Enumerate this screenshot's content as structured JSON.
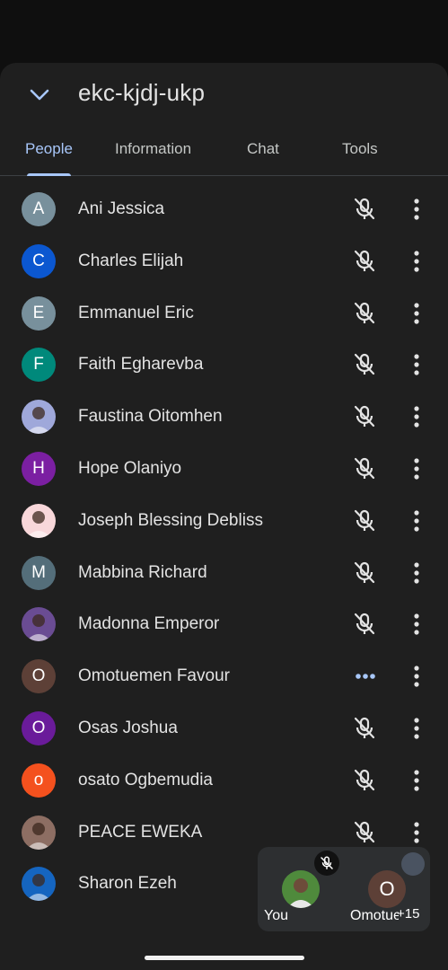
{
  "meeting": {
    "code": "ekc-kjdj-ukp"
  },
  "tabs": [
    {
      "label": "People",
      "active": true
    },
    {
      "label": "Information",
      "active": false
    },
    {
      "label": "Chat",
      "active": false
    },
    {
      "label": "Tools",
      "active": false
    }
  ],
  "participants": [
    {
      "name": "Ani Jessica",
      "initial": "A",
      "color": "#78909c",
      "status": "muted"
    },
    {
      "name": "Charles Elijah",
      "initial": "C",
      "color": "#0b57d0",
      "status": "muted"
    },
    {
      "name": "Emmanuel Eric",
      "initial": "E",
      "color": "#78909c",
      "status": "muted"
    },
    {
      "name": "Faith Egharevba",
      "initial": "F",
      "color": "#00897b",
      "status": "muted"
    },
    {
      "name": "Faustina Oitomhen",
      "initial": "",
      "color": "#9fa8da",
      "status": "muted"
    },
    {
      "name": "Hope Olaniyo",
      "initial": "H",
      "color": "#7b1fa2",
      "status": "muted"
    },
    {
      "name": "Joseph Blessing Debliss",
      "initial": "",
      "color": "#f8d7da",
      "status": "muted"
    },
    {
      "name": "Mabbina Richard",
      "initial": "M",
      "color": "#546e7a",
      "status": "muted"
    },
    {
      "name": "Madonna Emperor",
      "initial": "",
      "color": "#6a4c93",
      "status": "muted"
    },
    {
      "name": "Omotuemen Favour",
      "initial": "O",
      "color": "#5d4037",
      "status": "speaking"
    },
    {
      "name": "Osas Joshua",
      "initial": "O",
      "color": "#6a1b9a",
      "status": "muted"
    },
    {
      "name": "osato Ogbemudia",
      "initial": "o",
      "color": "#f4511e",
      "status": "muted"
    },
    {
      "name": "PEACE EWEKA",
      "initial": "",
      "color": "#8d6e63",
      "status": "muted"
    },
    {
      "name": "Sharon Ezeh",
      "initial": "",
      "color": "#1565c0",
      "status": "muted"
    }
  ],
  "pip": {
    "self_label": "You",
    "other_initial": "O",
    "other_label": "Omotuemen",
    "extra_count": "+15"
  },
  "colors": {
    "accent": "#a8c7fa",
    "sheet": "#1f1f1f",
    "background": "#0f0f0f"
  }
}
